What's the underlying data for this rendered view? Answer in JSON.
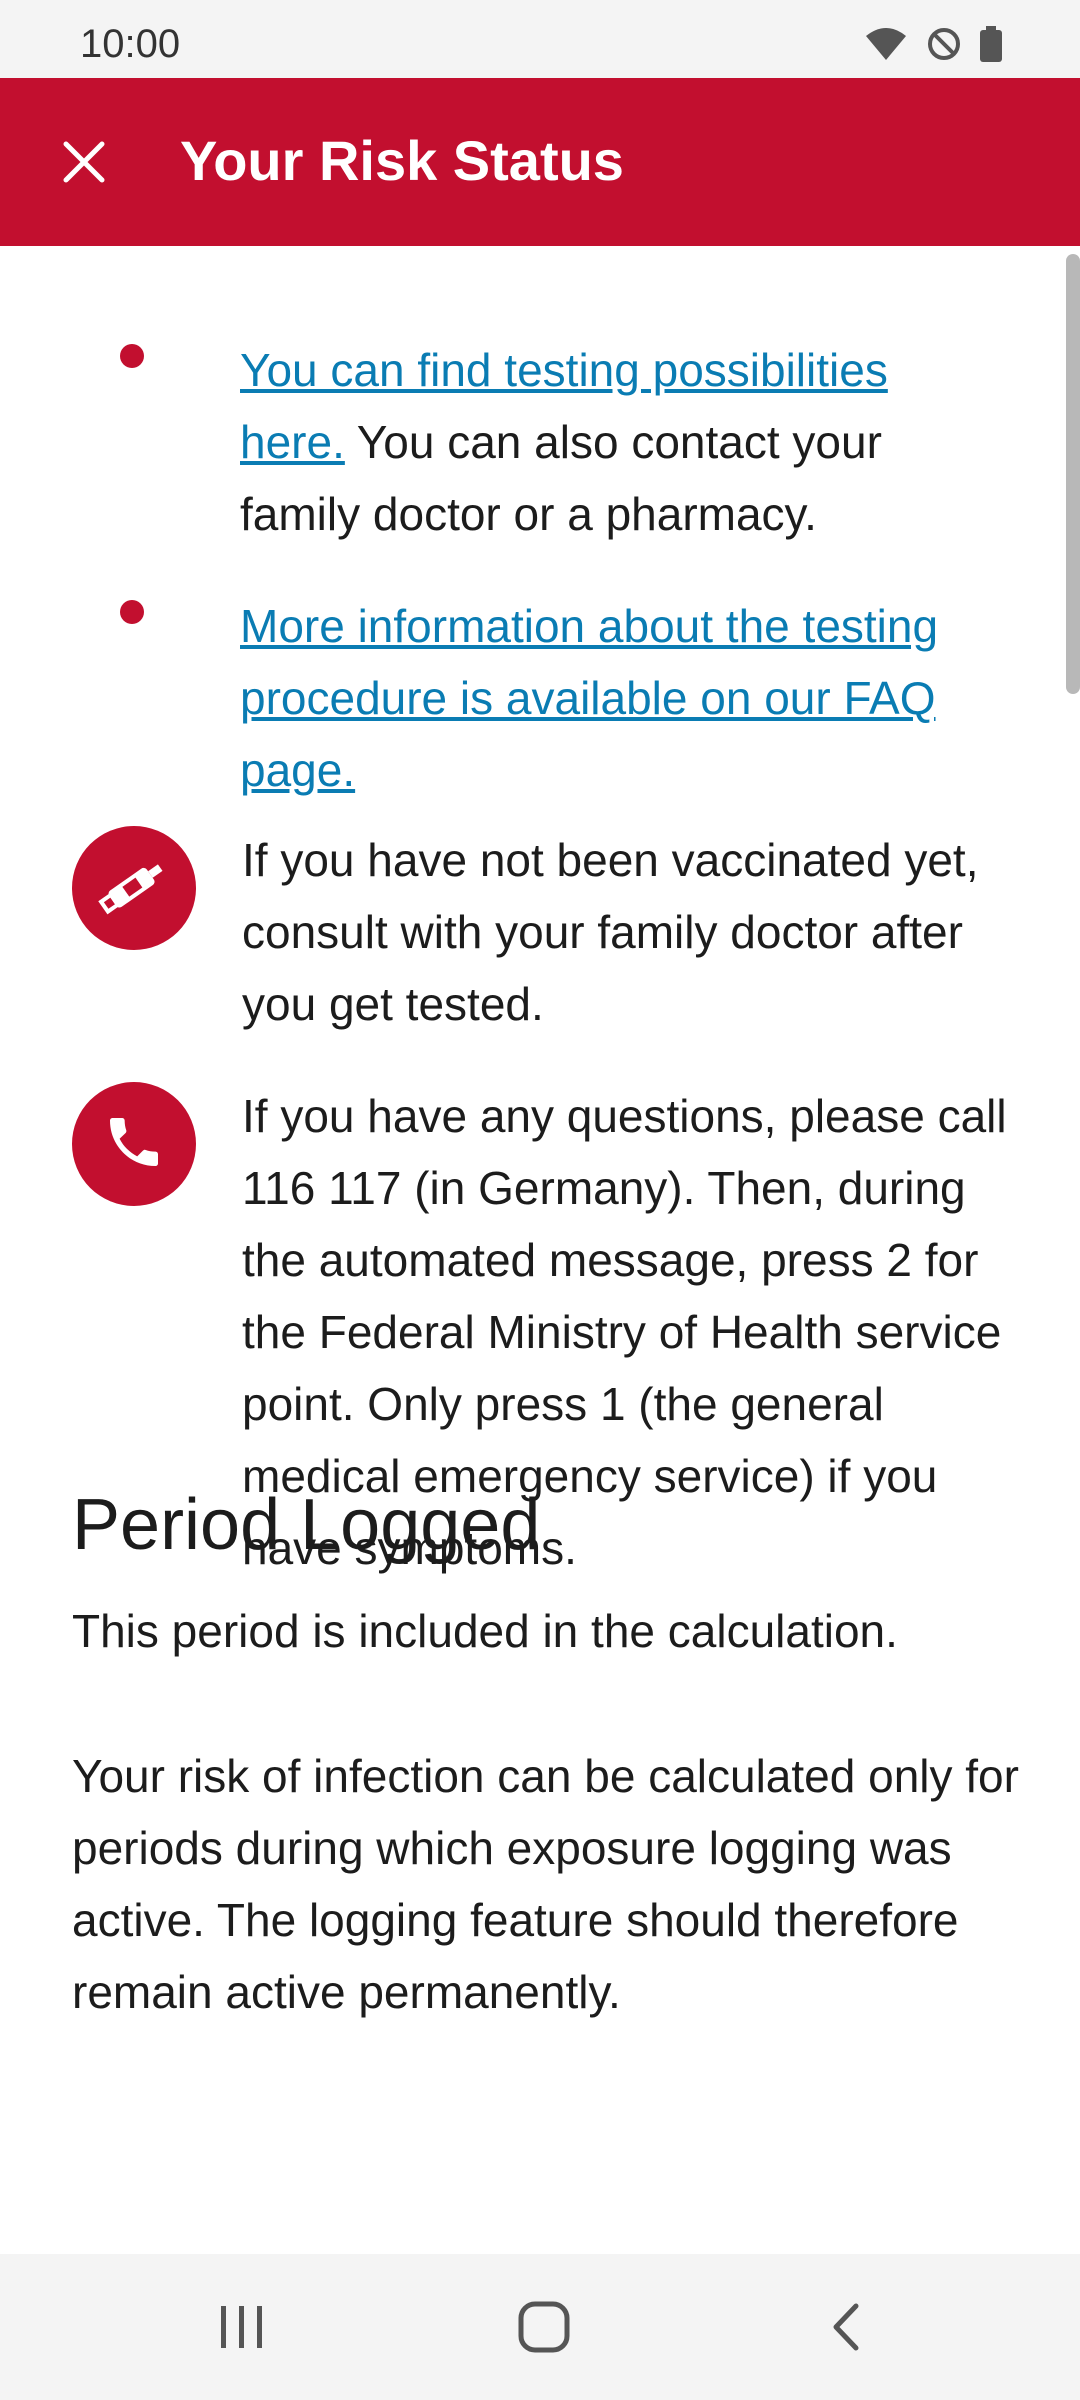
{
  "status_bar": {
    "time": "10:00",
    "icons": [
      "wifi-icon",
      "do-not-disturb-icon",
      "battery-icon"
    ]
  },
  "app_bar": {
    "title": "Your Risk Status",
    "close_icon": "close-icon"
  },
  "bullets": [
    {
      "link_text": "You can find testing possibilities here.",
      "text": " You can also contact your family doctor or a pharmacy."
    },
    {
      "link_text": "More information about the testing procedure is available on our FAQ page.",
      "text": ""
    }
  ],
  "info_items": [
    {
      "icon": "vaccine-syringe-icon",
      "text": "If you have not been vaccinated yet, consult with your family doctor after you get tested."
    },
    {
      "icon": "phone-icon",
      "text": "If you have any questions, please call 116 117 (in Germany). Then, during the automated message, press 2 for the Federal Ministry of Health service point. Only press 1 (the general medical emergency service) if you have symptoms."
    }
  ],
  "period_section": {
    "title": "Period Logged",
    "subtitle": "This period is included in the calculation.",
    "body": "Your risk of infection can be calculated only for periods during which exposure logging was active. The logging feature should therefore remain active permanently."
  },
  "nav_bar": {
    "icons": [
      "recent-apps-icon",
      "home-icon",
      "back-icon"
    ]
  },
  "colors": {
    "brand_red": "#c20f2f",
    "link_blue": "#0a7cb3"
  }
}
